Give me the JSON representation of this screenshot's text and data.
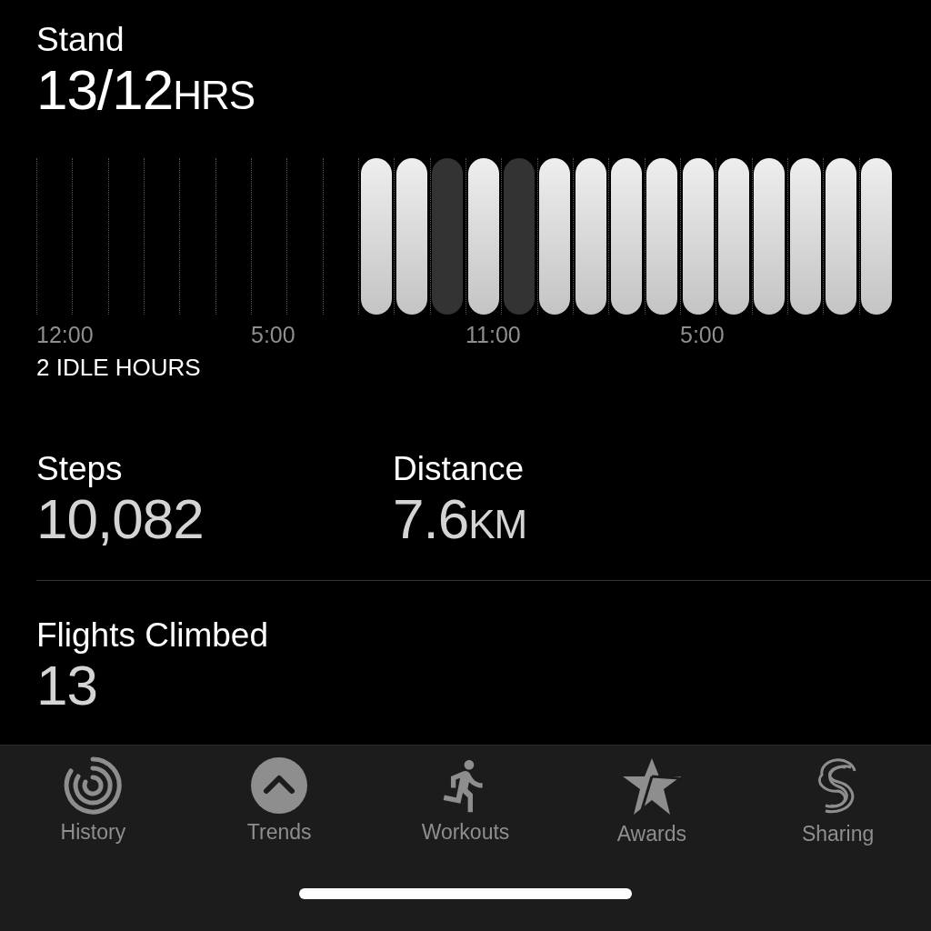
{
  "stand": {
    "title": "Stand",
    "value": "13/12",
    "unit": "HRS",
    "hours": [
      {
        "kind": "none"
      },
      {
        "kind": "none"
      },
      {
        "kind": "none"
      },
      {
        "kind": "none"
      },
      {
        "kind": "none"
      },
      {
        "kind": "none"
      },
      {
        "kind": "none"
      },
      {
        "kind": "none"
      },
      {
        "kind": "none"
      },
      {
        "kind": "stood"
      },
      {
        "kind": "stood"
      },
      {
        "kind": "idle"
      },
      {
        "kind": "stood"
      },
      {
        "kind": "idle"
      },
      {
        "kind": "stood"
      },
      {
        "kind": "stood"
      },
      {
        "kind": "stood"
      },
      {
        "kind": "stood"
      },
      {
        "kind": "stood"
      },
      {
        "kind": "stood"
      },
      {
        "kind": "stood"
      },
      {
        "kind": "stood"
      },
      {
        "kind": "stood"
      },
      {
        "kind": "stood"
      }
    ],
    "time_labels": [
      "12:00",
      "5:00",
      "11:00",
      "5:00"
    ],
    "note": "2 IDLE HOURS"
  },
  "metrics": [
    {
      "title": "Steps",
      "value": "10,082"
    },
    {
      "title": "Distance",
      "value": "7.6",
      "unit": "KM"
    }
  ],
  "flights": {
    "title": "Flights Climbed",
    "value": "13"
  },
  "tab_bar": [
    {
      "label": "History"
    },
    {
      "label": "Trends"
    },
    {
      "label": "Workouts"
    },
    {
      "label": "Awards"
    },
    {
      "label": "Sharing"
    }
  ]
}
